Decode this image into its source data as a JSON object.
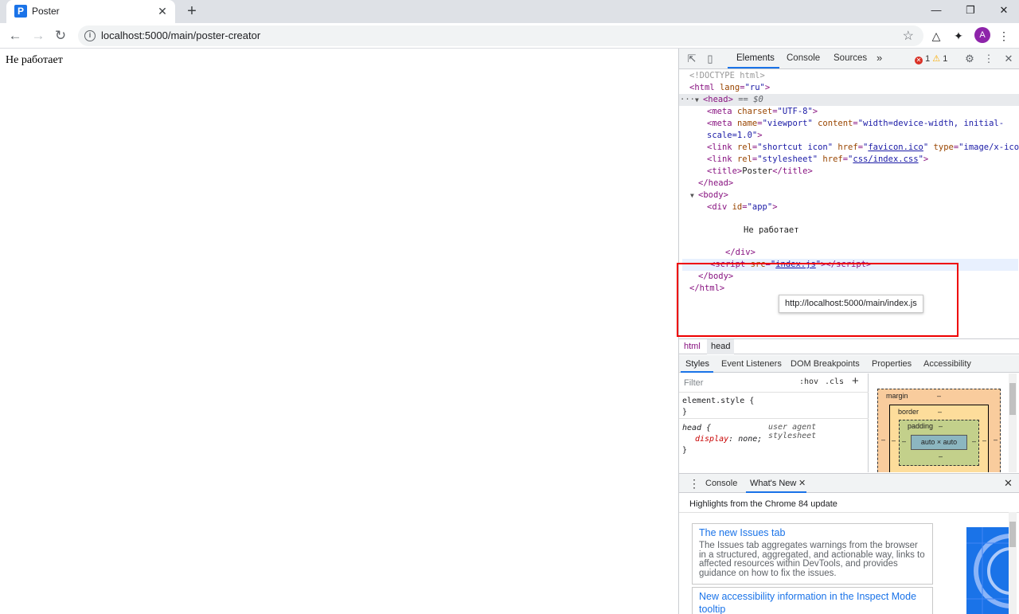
{
  "browser": {
    "tab_title": "Poster",
    "favicon_letter": "P",
    "url": "localhost:5000/main/poster-creator",
    "avatar_letter": "A"
  },
  "page": {
    "text": "Не работает"
  },
  "devtools": {
    "tabs": [
      "Elements",
      "Console",
      "Sources"
    ],
    "more": "»",
    "errors": "1",
    "warnings": "1",
    "dom": {
      "doctype": "<!DOCTYPE html>",
      "selected_marker": "== $0",
      "body_text": "Не работает",
      "tooltip": "http://localhost:5000/main/index.js"
    },
    "breadcrumbs": [
      "html",
      "head"
    ],
    "sub_tabs": [
      "Styles",
      "Event Listeners",
      "DOM Breakpoints",
      "Properties",
      "Accessibility"
    ],
    "styles": {
      "filter_placeholder": "Filter",
      "hov": ":hov",
      "cls": ".cls",
      "element_style": "element.style {",
      "close_brace": "}",
      "head_selector": "head {",
      "ua_label": "user agent stylesheet",
      "prop": "display",
      "value": "none;"
    },
    "box_model": {
      "margin": "margin",
      "border": "border",
      "padding": "padding",
      "content": "auto × auto",
      "dash": "–"
    },
    "drawer": {
      "tabs": [
        "Console",
        "What's New"
      ],
      "highlights": "Highlights from the Chrome 84 update",
      "cards": [
        {
          "title": "The new Issues tab",
          "body": "The Issues tab aggregates warnings from the browser in a structured, aggregated, and actionable way, links to affected resources within DevTools, and provides guidance on how to fix the issues."
        },
        {
          "title": "New accessibility information in the Inspect Mode tooltip",
          "body": ""
        }
      ]
    }
  }
}
